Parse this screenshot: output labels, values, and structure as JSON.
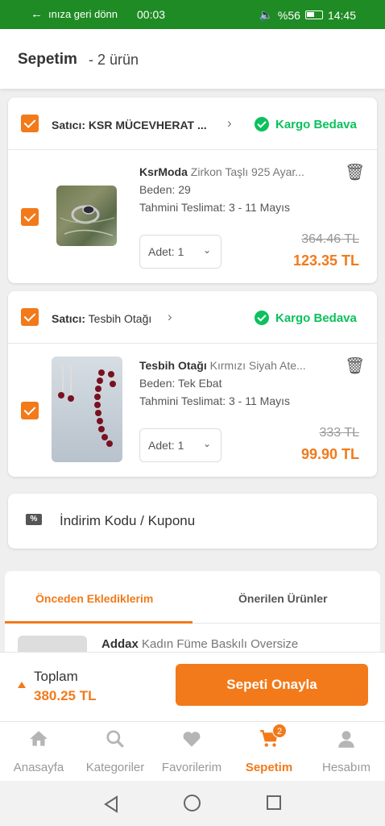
{
  "status_bar": {
    "back_text": "ınıza geri dönn",
    "clock_center": "00:03",
    "battery": "%56",
    "time": "14:45"
  },
  "header": {
    "title": "Sepetim",
    "count": "- 2 ürün"
  },
  "sellers": [
    {
      "label": "Satıcı:",
      "name": "KSR MÜCEVHERAT ...",
      "shipping": "Kargo Bedava",
      "product": {
        "brand": "KsrModa",
        "title": "Zirkon Taşlı 925 Ayar...",
        "size": "Beden: 29",
        "delivery": "Tahmini Teslimat: 3 - 11 Mayıs",
        "qty": "Adet: 1",
        "old_price": "364.46 TL",
        "price": "123.35 TL"
      }
    },
    {
      "label": "Satıcı:",
      "name": "Tesbih Otağı",
      "shipping": "Kargo Bedava",
      "product": {
        "brand": "Tesbih Otağı",
        "title": "Kırmızı Siyah Ate...",
        "size": "Beden: Tek Ebat",
        "delivery": "Tahmini Teslimat: 3 - 11 Mayıs",
        "qty": "Adet: 1",
        "old_price": "333 TL",
        "price": "99.90 TL"
      }
    }
  ],
  "coupon": {
    "icon": "coupon-icon",
    "label": "İndirim Kodu / Kuponu"
  },
  "tabs": {
    "active": "Önceden Eklediklerim",
    "other": "Önerilen Ürünler",
    "preview_brand": "Addax",
    "preview_title": "Kadın Füme Baskılı Oversize"
  },
  "summary": {
    "label": "Toplam",
    "total": "380.25 TL",
    "confirm": "Sepeti Onayla"
  },
  "bottom_nav": [
    {
      "label": "Anasayfa",
      "icon": "home-icon"
    },
    {
      "label": "Kategoriler",
      "icon": "search-icon"
    },
    {
      "label": "Favorilerim",
      "icon": "heart-icon"
    },
    {
      "label": "Sepetim",
      "icon": "cart-icon",
      "badge": "2"
    },
    {
      "label": "Hesabım",
      "icon": "user-icon"
    }
  ],
  "colors": {
    "accent": "#f27a1a",
    "success": "#0bc15c",
    "statusbar": "#1f8b24"
  }
}
